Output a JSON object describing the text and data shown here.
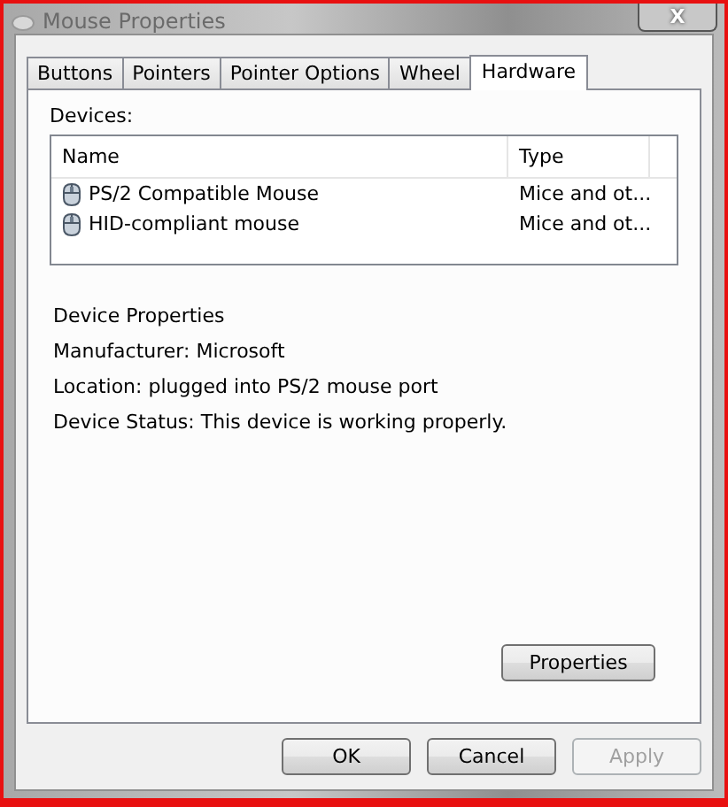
{
  "window": {
    "title": "Mouse Properties",
    "close": "X"
  },
  "tabs": [
    {
      "label": "Buttons",
      "selected": false
    },
    {
      "label": "Pointers",
      "selected": false
    },
    {
      "label": "Pointer Options",
      "selected": false
    },
    {
      "label": "Wheel",
      "selected": false
    },
    {
      "label": "Hardware",
      "selected": true
    }
  ],
  "devices": {
    "label": "Devices:",
    "columns": [
      "Name",
      "Type"
    ],
    "rows": [
      {
        "name": "PS/2 Compatible Mouse",
        "type": "Mice and ot..."
      },
      {
        "name": "HID-compliant mouse",
        "type": "Mice and ot..."
      }
    ]
  },
  "device_properties": {
    "heading": "Device Properties",
    "lines": [
      "Manufacturer: Microsoft",
      "Location: plugged into PS/2 mouse port",
      "Device Status: This device is working properly."
    ]
  },
  "properties_button": "Properties",
  "buttons": [
    {
      "label": "OK",
      "disabled": false
    },
    {
      "label": "Cancel",
      "disabled": false
    },
    {
      "label": "Apply",
      "disabled": true
    }
  ]
}
